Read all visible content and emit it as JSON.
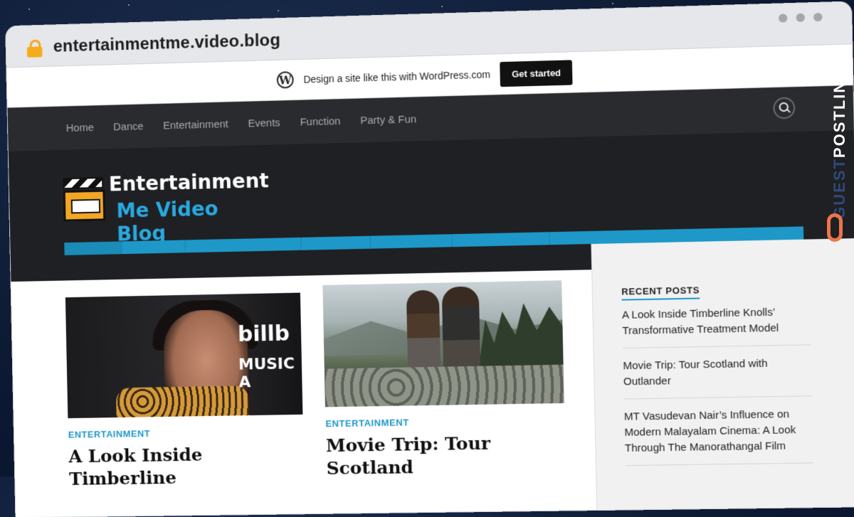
{
  "browser": {
    "url": "entertainmentme.video.blog"
  },
  "wpbar": {
    "text": "Design a site like this with WordPress.com",
    "button": "Get started"
  },
  "topnav": {
    "items": [
      "Home",
      "Dance",
      "Entertainment",
      "Events",
      "Function",
      "Party & Fun"
    ]
  },
  "logo": {
    "line1": "Entertainment",
    "line2": "Me Video Blog"
  },
  "mainnav": {
    "items": [
      "HOME",
      "DANCE",
      "ENTERTAINMENT",
      "EVENTS",
      "FUNCTION",
      "PARTY & FUN"
    ]
  },
  "posts": [
    {
      "category": "ENTERTAINMENT",
      "title": "A Look Inside Timberline",
      "image_text_1": "billb",
      "image_text_2": "MUSIC A"
    },
    {
      "category": "ENTERTAINMENT",
      "title": "Movie Trip: Tour Scotland"
    }
  ],
  "sidebar": {
    "recent_title": "RECENT POSTS",
    "recent": [
      "A Look Inside Timberline Knolls’ Transformative Treatment Model",
      "Movie Trip: Tour Scotland with Outlander",
      "MT Vasudevan Nair’s Influence on Modern Malayalam Cinema: A Look Through The Manorathangal Film"
    ]
  },
  "watermark": {
    "brand_a": "GUEST",
    "brand_b": "POSTLINKS"
  },
  "colors": {
    "accent": "#1e98c8",
    "header_bg": "#1f2023",
    "topnav_bg": "#2a2b2e",
    "lock": "#f5ac1c"
  },
  "icons": [
    "lock-icon",
    "wordpress-icon",
    "search-icon",
    "clapperboard-icon",
    "link-icon"
  ]
}
